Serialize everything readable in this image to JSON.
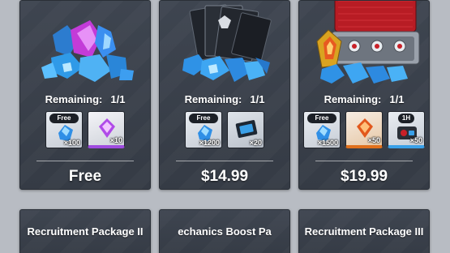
{
  "packages": [
    {
      "remaining_label": "Remaining:",
      "remaining_value": "1/1",
      "items": [
        {
          "tag": "Free",
          "qty": "100",
          "icon": "blue-gem-icon"
        },
        {
          "tag": "",
          "qty": "10",
          "icon": "purple-crystal-icon"
        }
      ],
      "price": "Free"
    },
    {
      "remaining_label": "Remaining:",
      "remaining_value": "1/1",
      "items": [
        {
          "tag": "Free",
          "qty": "1200",
          "icon": "blue-gem-icon"
        },
        {
          "tag": "",
          "qty": "20",
          "icon": "blue-card-icon"
        }
      ],
      "price": "$14.99"
    },
    {
      "remaining_label": "Remaining:",
      "remaining_value": "1/1",
      "items": [
        {
          "tag": "Free",
          "qty": "1500",
          "icon": "blue-gem-icon"
        },
        {
          "tag": "",
          "qty": "50",
          "icon": "orange-crystal-icon"
        },
        {
          "tag": "1H",
          "qty": "50",
          "icon": "timer-item-icon"
        }
      ],
      "price": "$19.99"
    }
  ],
  "bottom_cards": [
    {
      "title": "Recruitment Package II"
    },
    {
      "title": "echanics Boost Pa"
    },
    {
      "title": "Recruitment Package III"
    }
  ],
  "colors": {
    "card_bg": "#3e4550",
    "page_bg": "#b8bcc3",
    "gem_blue": "#3aa0e8",
    "purple": "#a04ce0",
    "orange": "#e0701c",
    "red_case": "#c8202a"
  }
}
